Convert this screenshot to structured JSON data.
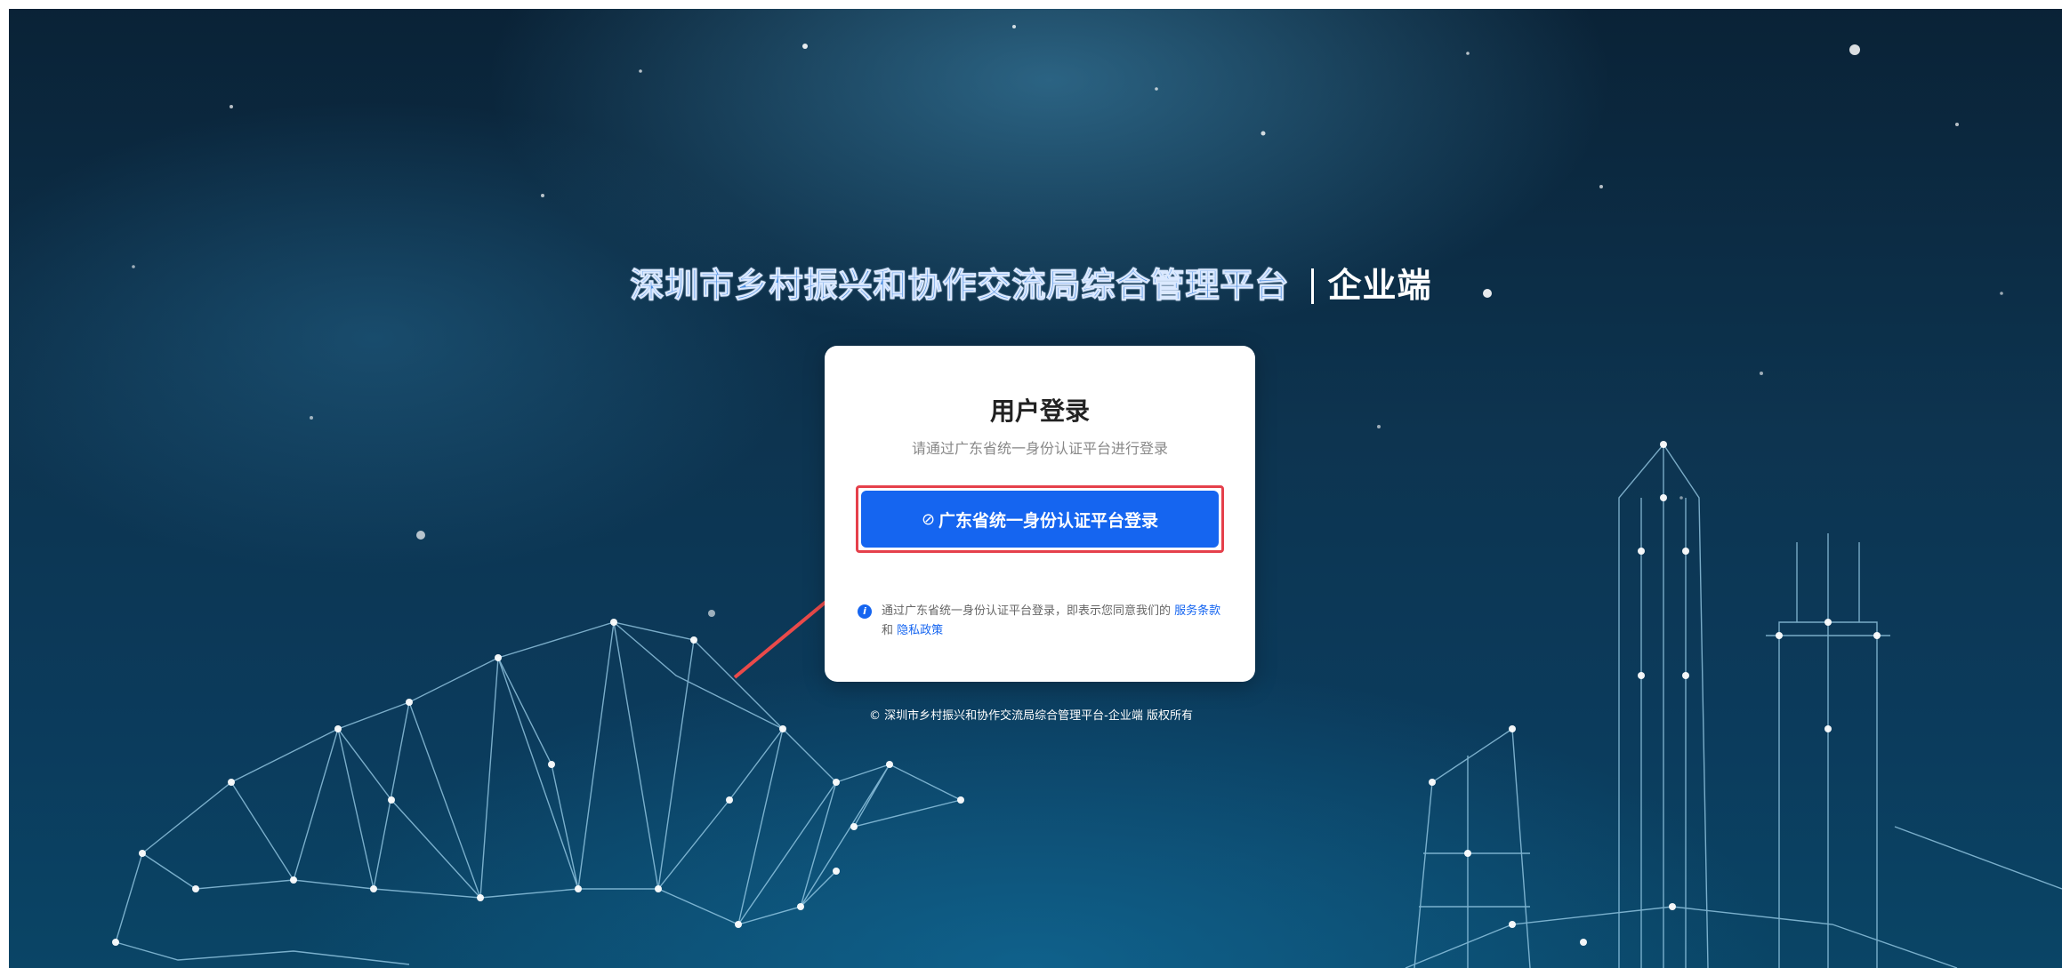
{
  "header": {
    "title": "深圳市乡村振兴和协作交流局综合管理平台",
    "subtitle": "企业端"
  },
  "login": {
    "title": "用户登录",
    "subtitle": "请通过广东省统一身份认证平台进行登录",
    "button_icon": "link-icon",
    "button_label": "广东省统一身份认证平台登录"
  },
  "agreement": {
    "icon": "info-icon",
    "text": "通过广东省统一身份认证平台登录，即表示您同意我们的",
    "terms_link": "服务条款",
    "and": "和",
    "privacy_link": "隐私政策"
  },
  "footer": {
    "copyright": "© 深圳市乡村振兴和协作交流局综合管理平台-企业端 版权所有"
  },
  "colors": {
    "primary": "#1565f0",
    "highlight": "#e5404b",
    "title_blue": "#4b8de0"
  }
}
